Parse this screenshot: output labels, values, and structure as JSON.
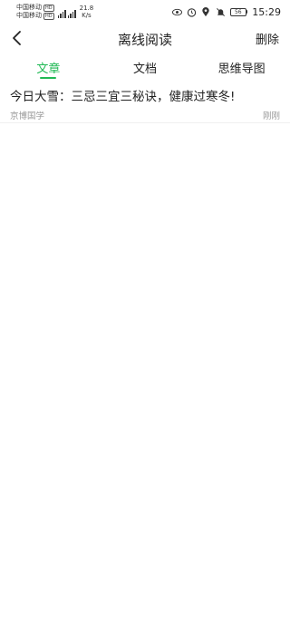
{
  "status_bar": {
    "carrier1": "中国移动",
    "carrier1_badge": "HD",
    "carrier2": "中国移动",
    "carrier2_badge": "HD",
    "net_type1": "4G",
    "net_type2": "4G",
    "net_speed_value": "21.8",
    "net_speed_unit": "K/s",
    "battery": "56",
    "time": "15:29",
    "icons": [
      "eye-icon",
      "alarm-icon",
      "location-icon",
      "bell-mute-icon"
    ]
  },
  "nav": {
    "title": "离线阅读",
    "delete_label": "删除",
    "back_icon": "chevron-left-icon"
  },
  "tabs": [
    {
      "label": "文章",
      "active": true
    },
    {
      "label": "文档",
      "active": false
    },
    {
      "label": "思维导图",
      "active": false
    }
  ],
  "articles": [
    {
      "title": "今日大雪：三忌三宜三秘诀，健康过寒冬!",
      "source": "京博国学",
      "time": "刚刚"
    }
  ],
  "colors": {
    "accent": "#1fb954",
    "text": "#222222",
    "muted": "#999999"
  }
}
